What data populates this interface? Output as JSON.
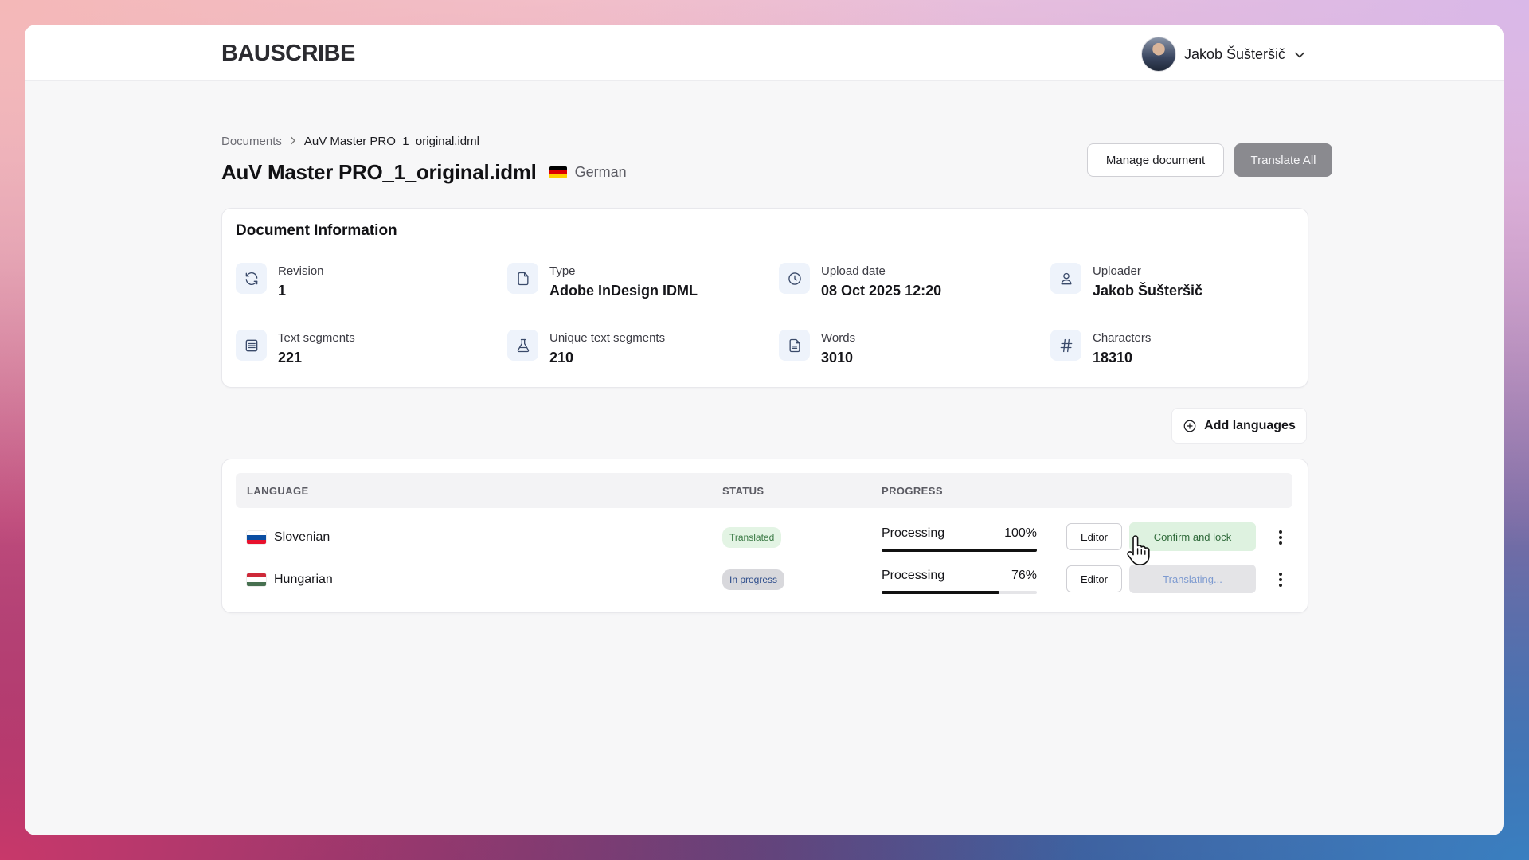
{
  "app": {
    "logo": "BAUSCRIBE",
    "user_name": "Jakob Šušteršič"
  },
  "breadcrumb": {
    "root": "Documents",
    "separator": ">",
    "current": "AuV Master PRO_1_original.idml"
  },
  "document": {
    "title": "AuV Master PRO_1_original.idml",
    "source_language": "German",
    "source_flag_icon": "flag-germany-icon"
  },
  "actions": {
    "manage_label": "Manage document",
    "translate_all_label": "Translate All",
    "add_languages_label": "Add languages"
  },
  "info": {
    "title": "Document Information",
    "items": [
      {
        "label": "Revision",
        "value": "1",
        "icon": "refresh-icon"
      },
      {
        "label": "Type",
        "value": "Adobe InDesign IDML",
        "icon": "file-icon"
      },
      {
        "label": "Upload date",
        "value": "08 Oct 2025 12:20",
        "icon": "clock-icon"
      },
      {
        "label": "Uploader",
        "value": "Jakob Šušteršič",
        "icon": "user-icon"
      },
      {
        "label": "Text segments",
        "value": "221",
        "icon": "lines-icon"
      },
      {
        "label": "Unique text segments",
        "value": "210",
        "icon": "flask-icon"
      },
      {
        "label": "Words",
        "value": "3010",
        "icon": "document-text-icon"
      },
      {
        "label": "Characters",
        "value": "18310",
        "icon": "hash-icon"
      }
    ]
  },
  "table": {
    "headers": {
      "language": "LANGUAGE",
      "status": "STATUS",
      "progress": "PROGRESS"
    },
    "rows": [
      {
        "language": "Slovenian",
        "flag_icon": "flag-slovenia-icon",
        "status": "Translated",
        "progress_label": "Processing",
        "progress_percent": "100%",
        "progress_value": 100,
        "editor_label": "Editor",
        "action_label": "Confirm and lock"
      },
      {
        "language": "Hungarian",
        "flag_icon": "flag-hungary-icon",
        "status": "In progress",
        "progress_label": "Processing",
        "progress_percent": "76%",
        "progress_value": 76,
        "editor_label": "Editor",
        "action_label": "Translating..."
      }
    ]
  },
  "colors": {
    "status_translated_bg": "#e3f4e4",
    "status_in_progress_bg": "#d8d8dc",
    "confirm_bg": "#def2e0",
    "translate_all_bg": "#8a8a8f"
  }
}
